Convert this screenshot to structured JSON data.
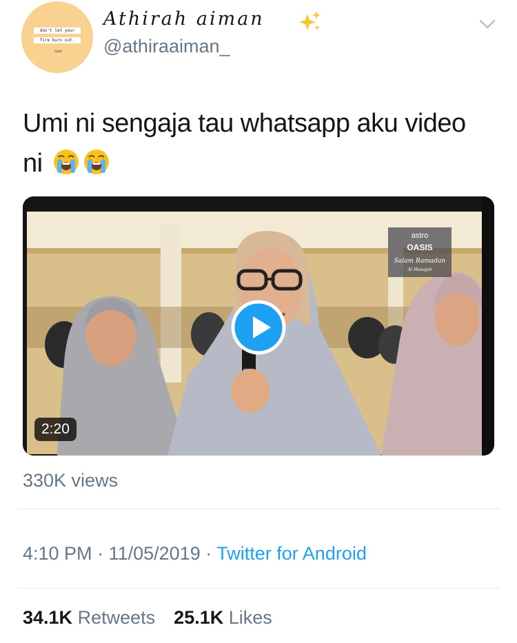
{
  "user": {
    "display_name": "Athirah aiman",
    "handle": "@athiraaiman_",
    "avatar": {
      "note_line_1": "don't let your",
      "note_line_2": "fire burn out.",
      "note_sign": "-God",
      "bg_color": "#f9d190"
    },
    "name_emoji": "sparkles-icon"
  },
  "tweet": {
    "text": "Umi ni sengaja tau whatsapp aku video ni",
    "emojis": [
      "loudly-crying-face-icon",
      "loudly-crying-face-icon"
    ]
  },
  "video": {
    "duration": "2:20",
    "views": "330K views",
    "overlay_logo_line_1": "astro",
    "overlay_logo_line_2": "OASIS",
    "overlay_logo_line_3": "Salam Ramadan",
    "overlay_logo_line_4": "Al Munajah"
  },
  "meta": {
    "time": "4:10 PM",
    "date": "11/05/2019",
    "separator": "·",
    "source": "Twitter for Android"
  },
  "stats": {
    "retweets_count": "34.1K",
    "retweets_label": "Retweets",
    "likes_count": "25.1K",
    "likes_label": "Likes"
  },
  "colors": {
    "link": "#1da1f2",
    "secondary_text": "#657786",
    "primary_text": "#14171a"
  }
}
